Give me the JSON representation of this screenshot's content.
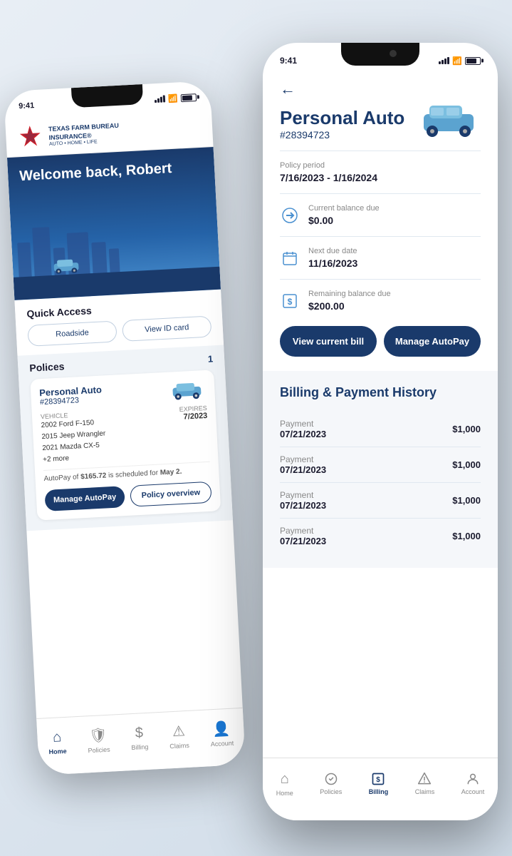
{
  "back_phone": {
    "status_time": "9:41",
    "header": {
      "company_name": "TEXAS FARM BUREAU",
      "company_subtitle": "INSURANCE®",
      "company_lines": "AUTO • HOME • LIFE"
    },
    "hero": {
      "welcome_text": "Welcome back, Robert"
    },
    "quick_access": {
      "title": "Quick Access",
      "buttons": [
        {
          "label": "Roadside"
        },
        {
          "label": "View ID card"
        }
      ]
    },
    "policies": {
      "title": "Polices",
      "count": "1",
      "card": {
        "name": "Personal Auto",
        "number": "#28394723",
        "vehicle_label": "Vehicle",
        "vehicles": [
          "2002 Ford F-150",
          "2015 Jeep Wrangler",
          "2021 Mazda CX-5",
          "+2 more"
        ],
        "expires_label": "Expires",
        "expires_date": "7/2023",
        "autopay_text": "AutoPay of $165.72 is scheduled for May 2.",
        "btn_manage": "Manage AutoPay",
        "btn_overview": "Policy overview"
      }
    },
    "nav": {
      "items": [
        {
          "label": "Home",
          "active": true
        },
        {
          "label": "Policies",
          "active": false
        },
        {
          "label": "Billing",
          "active": false
        },
        {
          "label": "Claims",
          "active": false
        },
        {
          "label": "Account",
          "active": false
        }
      ]
    }
  },
  "front_phone": {
    "status_time": "9:41",
    "policy": {
      "name": "Personal Auto",
      "number": "#28394723",
      "period_label": "Policy period",
      "period": "7/16/2023 - 1/16/2024",
      "balance_label": "Current balance due",
      "balance": "$0.00",
      "due_date_label": "Next due date",
      "due_date": "11/16/2023",
      "remaining_label": "Remaining balance due",
      "remaining": "$200.00"
    },
    "buttons": {
      "view_bill": "View current bill",
      "manage_autopay": "Manage AutoPay"
    },
    "billing": {
      "title": "Billing & Payment History",
      "payments": [
        {
          "label": "Payment",
          "date": "07/21/2023",
          "amount": "$1,000"
        },
        {
          "label": "Payment",
          "date": "07/21/2023",
          "amount": "$1,000"
        },
        {
          "label": "Payment",
          "date": "07/21/2023",
          "amount": "$1,000"
        },
        {
          "label": "Payment",
          "date": "07/21/2023",
          "amount": "$1,000"
        }
      ]
    },
    "nav": {
      "items": [
        {
          "label": "Home",
          "active": false
        },
        {
          "label": "Policies",
          "active": false
        },
        {
          "label": "Billing",
          "active": true
        },
        {
          "label": "Claims",
          "active": false
        },
        {
          "label": "Account",
          "active": false
        }
      ]
    }
  }
}
